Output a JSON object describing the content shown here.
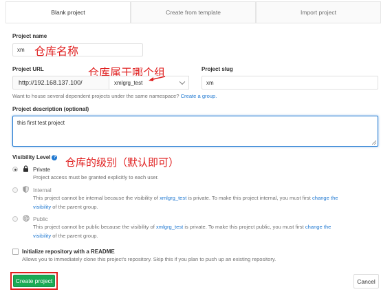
{
  "tabs": [
    {
      "label": "Blank project",
      "active": true
    },
    {
      "label": "Create from template",
      "active": false
    },
    {
      "label": "Import project",
      "active": false
    }
  ],
  "project_name": {
    "label": "Project name",
    "value": "xm"
  },
  "project_url": {
    "label": "Project URL",
    "prefix": "http://192.168.137.100/",
    "namespace": "xmlgrg_test",
    "help": "Want to house several dependent projects under the same namespace?",
    "help_link": "Create a group."
  },
  "project_slug": {
    "label": "Project slug",
    "value": "xm"
  },
  "description": {
    "label": "Project description (optional)",
    "value": "this first test project"
  },
  "visibility": {
    "label": "Visibility Level",
    "options": [
      {
        "title": "Private",
        "desc": "Project access must be granted explicitly to each user.",
        "checked": true,
        "disabled": false
      },
      {
        "title": "Internal",
        "desc_pre": "This project cannot be internal because the visibility of",
        "group": "xmlgrg_test",
        "desc_mid": "is private. To make this project internal, you must first",
        "link_a": "change the",
        "link_b": "visibility",
        "desc_post": "of the parent group.",
        "checked": false,
        "disabled": true
      },
      {
        "title": "Public",
        "desc_pre": "This project cannot be public because the visibility of",
        "group": "xmlgrg_test",
        "desc_mid": "is private. To make this project public, you must first",
        "link_a": "change the",
        "link_b": "visibility",
        "desc_post": "of the parent group.",
        "checked": false,
        "disabled": true
      }
    ]
  },
  "readme": {
    "label": "Initialize repository with a README",
    "desc": "Allows you to immediately clone this project's repository. Skip this if you plan to push up an existing repository.",
    "checked": false
  },
  "buttons": {
    "create": "Create project",
    "cancel": "Cancel"
  },
  "annotations": {
    "name": "仓库名称",
    "group": "仓库属于哪个组",
    "visibility": "仓库的级别（默认即可）"
  },
  "colors": {
    "accent": "#1f78d1",
    "success": "#1aaa55",
    "annotation": "#e02020"
  }
}
